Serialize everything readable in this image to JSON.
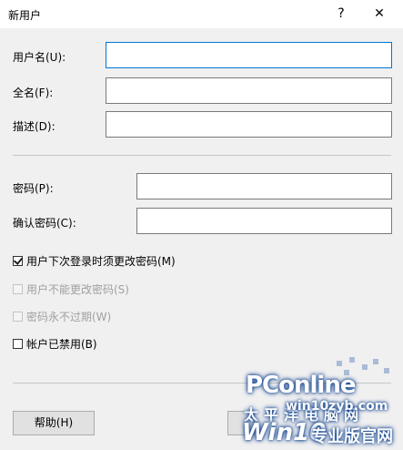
{
  "window": {
    "title": "新用户",
    "help_symbol": "?",
    "close_symbol": "✕"
  },
  "fields": {
    "username_label": "用户名(U):",
    "fullname_label": "全名(F):",
    "description_label": "描述(D):",
    "password_label": "密码(P):",
    "confirm_label": "确认密码(C):",
    "username_value": "",
    "fullname_value": "",
    "description_value": "",
    "password_value": "",
    "confirm_value": ""
  },
  "checkboxes": [
    {
      "label": "用户下次登录时须更改密码(M)",
      "checked": true,
      "enabled": true
    },
    {
      "label": "用户不能更改密码(S)",
      "checked": false,
      "enabled": false
    },
    {
      "label": "密码永不过期(W)",
      "checked": false,
      "enabled": false
    },
    {
      "label": "帐户已禁用(B)",
      "checked": false,
      "enabled": true
    }
  ],
  "buttons": {
    "help_label": "帮助(H)"
  },
  "watermark": {
    "pconline": "PConline",
    "cn_site": "太平洋电脑网",
    "url": "win10zyb.com",
    "win10": "Win10",
    "cn_title": "专业版官网"
  }
}
